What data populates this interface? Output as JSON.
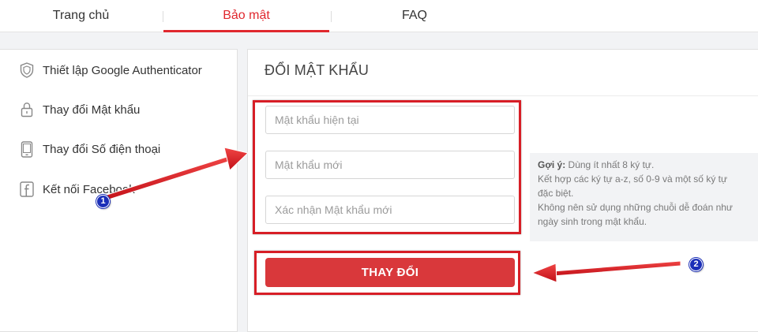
{
  "tabs": {
    "home": "Trang chủ",
    "security": "Bảo mật",
    "faq": "FAQ"
  },
  "sidebar": {
    "items": [
      {
        "label": "Thiết lập Google Authenticator",
        "icon": "shield-icon"
      },
      {
        "label": "Thay đổi Mật khẩu",
        "icon": "lock-icon"
      },
      {
        "label": "Thay đổi Số điện thoại",
        "icon": "phone-icon"
      },
      {
        "label": "Kết nối Facebook",
        "icon": "facebook-icon"
      }
    ]
  },
  "form": {
    "title": "ĐỔI MẬT KHẨU",
    "current_password_placeholder": "Mật khẩu hiện tại",
    "new_password_placeholder": "Mật khẩu mới",
    "confirm_password_placeholder": "Xác nhận Mật khẩu mới",
    "submit_label": "THAY ĐỔI"
  },
  "hint": {
    "title": "Gợi ý:",
    "line1": " Dùng ít nhất 8 ký tự.",
    "line2": "Kết hợp các ký tự a-z, số 0-9 và một số ký tự",
    "line3": "đặc biệt.",
    "line4": "Không nên sử dụng những chuỗi dễ đoán như",
    "line5": "ngày sinh trong mật khẩu."
  },
  "annotations": {
    "badge_1": "1",
    "badge_2": "2"
  },
  "colors": {
    "accent": "#e0282e",
    "button": "#d9383b",
    "annotation_red": "#d71e26",
    "badge_blue": "#1b2fb8"
  }
}
